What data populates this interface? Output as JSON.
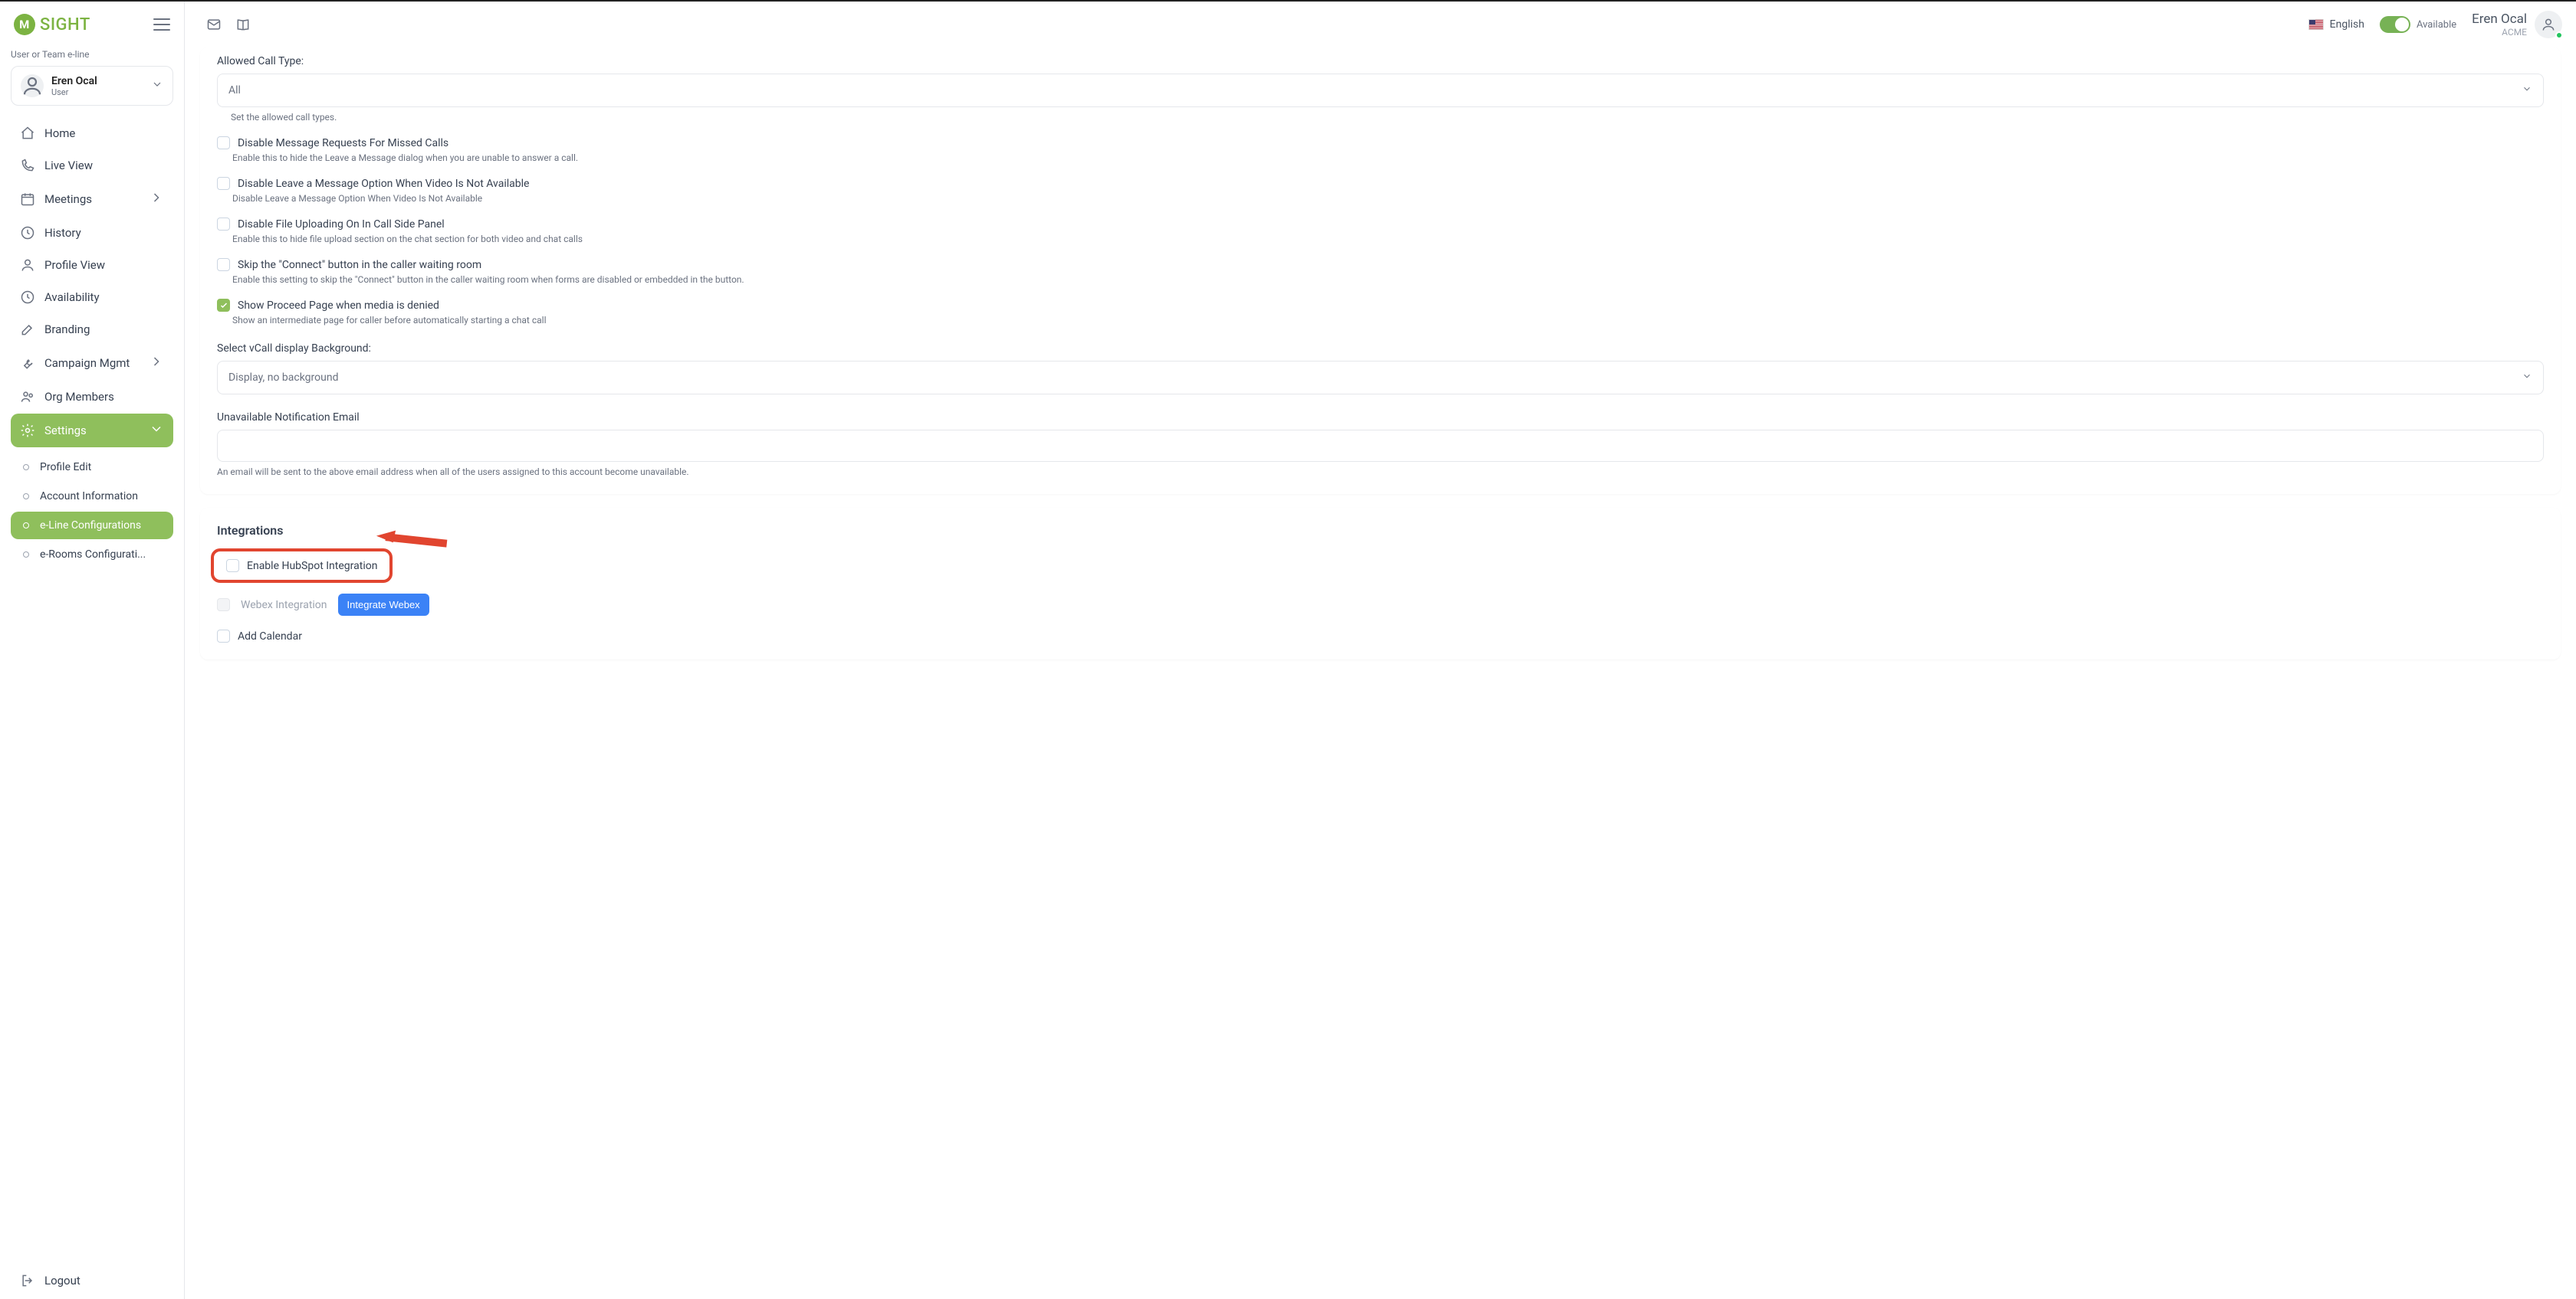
{
  "brand": "SIGHT",
  "sidebar": {
    "section_label": "User or Team e-line",
    "team": {
      "name": "Eren Ocal",
      "role": "User"
    },
    "items": [
      {
        "label": "Home"
      },
      {
        "label": "Live View"
      },
      {
        "label": "Meetings"
      },
      {
        "label": "History"
      },
      {
        "label": "Profile View"
      },
      {
        "label": "Availability"
      },
      {
        "label": "Branding"
      },
      {
        "label": "Campaign Mgmt"
      },
      {
        "label": "Org Members"
      },
      {
        "label": "Settings"
      }
    ],
    "settings_sub": [
      {
        "label": "Profile Edit"
      },
      {
        "label": "Account Information"
      },
      {
        "label": "e-Line Configurations"
      },
      {
        "label": "e-Rooms Configurati..."
      }
    ],
    "logout": "Logout"
  },
  "topbar": {
    "language": "English",
    "availability": "Available",
    "user_name": "Eren Ocal",
    "org": "ACME"
  },
  "form": {
    "allowed_call_type_label": "Allowed Call Type:",
    "allowed_call_type_value": "All",
    "allowed_call_type_hint": "Set the allowed call types.",
    "c1_label": "Disable Message Requests For Missed Calls",
    "c1_desc": "Enable this to hide the Leave a Message dialog when you are unable to answer a call.",
    "c2_label": "Disable Leave a Message Option When Video Is Not Available",
    "c2_desc": "Disable Leave a Message Option When Video Is Not Available",
    "c3_label": "Disable File Uploading On In Call Side Panel",
    "c3_desc": "Enable this to hide file upload section on the chat section for both video and chat calls",
    "c4_label": "Skip the \"Connect\" button in the caller waiting room",
    "c4_desc": "Enable this setting to skip the \"Connect\" button in the caller waiting room when forms are disabled or embedded in the button.",
    "c5_label": "Show Proceed Page when media is denied",
    "c5_desc": "Show an intermediate page for caller before automatically starting a chat call",
    "bg_label": "Select vCall display Background:",
    "bg_value": "Display, no background",
    "email_label": "Unavailable Notification Email",
    "email_hint": "An email will be sent to the above email address when all of the users assigned to this account become unavailable."
  },
  "integrations": {
    "title": "Integrations",
    "hubspot": "Enable HubSpot Integration",
    "webex": "Webex Integration",
    "webex_btn": "Integrate Webex",
    "calendar": "Add Calendar"
  }
}
